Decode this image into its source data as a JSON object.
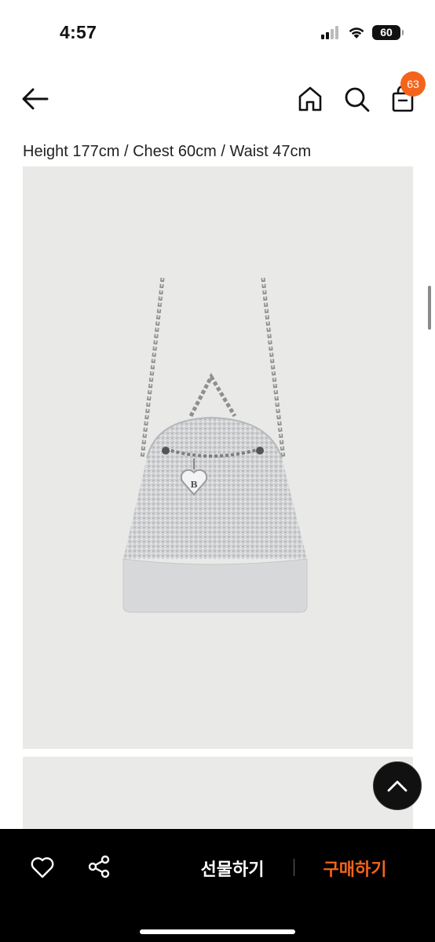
{
  "status_bar": {
    "time": "4:57",
    "battery": "60",
    "icons": [
      "signal-icon",
      "wifi-icon",
      "battery-icon"
    ]
  },
  "nav": {
    "icons": [
      "back-arrow-icon",
      "home-icon",
      "search-icon",
      "shopping-bag-icon"
    ],
    "cart_badge": "63"
  },
  "product": {
    "size_info": "Height 177cm / Chest 60cm / Waist 47cm",
    "image": "tweed bucket backpack with chain straps and heart charm",
    "charm_letter": "B"
  },
  "bottom_bar": {
    "icons": [
      "heart-icon",
      "share-icon"
    ],
    "gift_label": "선물하기",
    "buy_label": "구매하기"
  },
  "colors": {
    "accent": "#f4641c",
    "bottom_bar_bg": "#000000",
    "image_bg": "#e9e9e7"
  }
}
